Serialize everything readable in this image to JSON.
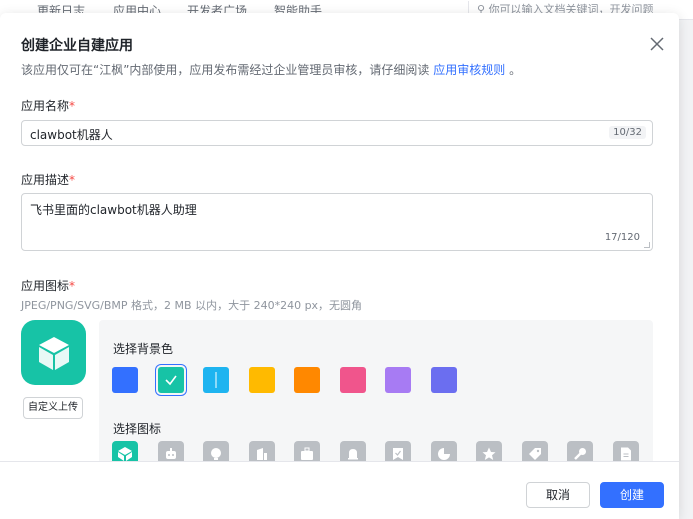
{
  "background": {
    "nav": [
      "更新日志",
      "应用中心",
      "开发者广场",
      "智能助手"
    ],
    "search_placeholder": "你可以输入文档关键词，开发问题"
  },
  "modal": {
    "title": "创建企业自建应用",
    "subtitle_prefix": "该应用仅可在“江枫”内部使用，应用发布需经过企业管理员审核，请仔细阅读",
    "subtitle_link": "应用审核规则",
    "subtitle_suffix": "。",
    "name": {
      "label": "应用名称",
      "required_mark": "*",
      "value": "clawbot机器人",
      "counter": "10/32"
    },
    "description": {
      "label": "应用描述",
      "required_mark": "*",
      "value": "飞书里面的clawbot机器人助理",
      "counter": "17/120"
    },
    "icon": {
      "label": "应用图标",
      "required_mark": "*",
      "hint": "JPEG/PNG/SVG/BMP 格式，2 MB 以内，大于 240*240 px，无圆角",
      "upload_label": "自定义上传",
      "preview_color": "#17c3a6",
      "bg_color_label": "选择背景色",
      "bg_colors": [
        "#3370ff",
        "#17c3a6",
        "#1eb4f0",
        "#ffba00",
        "#ff8800",
        "#f0558c",
        "#a77bf3",
        "#6b6ef0"
      ],
      "selected_bg_index": 1,
      "icon_label": "选择图标",
      "icons": [
        "cube-icon",
        "robot-icon",
        "bulb-icon",
        "building-icon",
        "briefcase-icon",
        "bell-icon",
        "bookmark-check-icon",
        "pie-chart-icon",
        "star-icon",
        "tag-icon",
        "wrench-icon",
        "document-icon"
      ],
      "selected_icon_index": 0
    },
    "footer": {
      "cancel_label": "取消",
      "create_label": "创建"
    }
  },
  "colors": {
    "accent": "#3370ff",
    "required": "#f54a45",
    "teal": "#17c3a6"
  }
}
